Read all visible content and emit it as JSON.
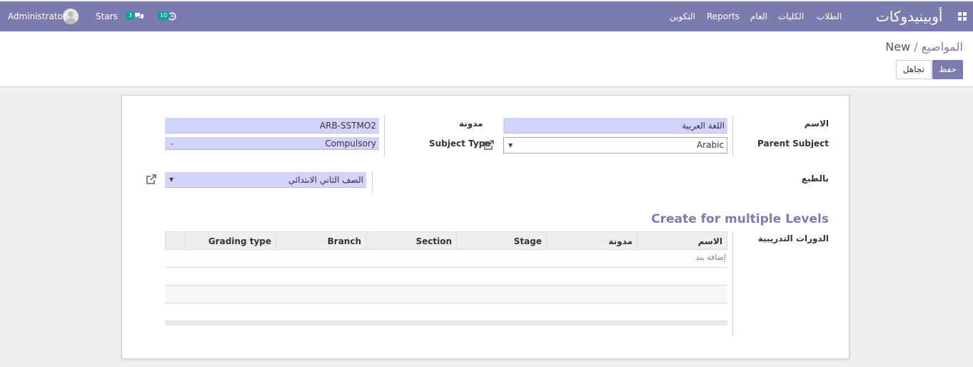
{
  "navbar": {
    "brand": "أوبينيدوكات",
    "menu": [
      "الطلاب",
      "الكليات",
      "العام",
      "Reports",
      "التكوين"
    ],
    "stars_label": "Stars",
    "messages_count": "3",
    "activity_count": "10",
    "user_name": "Administrator"
  },
  "breadcrumb": {
    "parent": "المواضيع",
    "sep": "/",
    "current": "New"
  },
  "buttons": {
    "save": "حفظ",
    "discard": "تجاهل"
  },
  "form": {
    "name_label": "الاسم",
    "name_value": "اللغة العربية",
    "parent_subject_label": "Parent Subject",
    "parent_subject_value": "Arabic",
    "code_label": "مدونة",
    "code_value": "ARB-SSTMO2",
    "subject_type_label": "Subject Type",
    "subject_type_value": "Compulsory",
    "nature_label": "بالطبع",
    "nature_value": "الصف الثاني الابتدائي",
    "multi_levels_title": "Create for multiple Levels",
    "courses_label": "الدورات التدريبية"
  },
  "table": {
    "columns": [
      "الاسم",
      "مدونة",
      "Stage",
      "Section",
      "Branch",
      "Grading type"
    ],
    "add_line": "إضافة بند"
  },
  "colors": {
    "primary": "#7c7bad",
    "required_field": "#d2d2ff",
    "badge": "#00a09d"
  }
}
